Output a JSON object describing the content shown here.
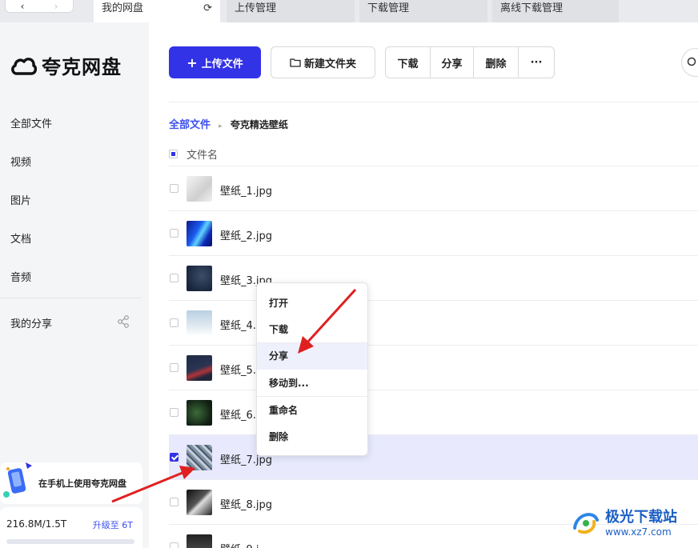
{
  "nav": {
    "back_icon": "chevron-left-icon",
    "forward_icon": "chevron-right-icon"
  },
  "tabs": [
    {
      "label": "我的网盘"
    },
    {
      "label": "上传管理"
    },
    {
      "label": "下载管理"
    },
    {
      "label": "离线下载管理"
    }
  ],
  "sidebar": {
    "app_name": "夸克网盘",
    "items": [
      {
        "label": "全部文件"
      },
      {
        "label": "视频"
      },
      {
        "label": "图片"
      },
      {
        "label": "文档"
      },
      {
        "label": "音频"
      },
      {
        "label": "我的分享"
      }
    ],
    "promo_text": "在手机上使用夸克网盘",
    "storage_used": "216.8M/1.5T",
    "upgrade_label": "升级至 6T"
  },
  "toolbar": {
    "upload_label": "上传文件",
    "new_folder_label": "新建文件夹",
    "download_label": "下载",
    "share_label": "分享",
    "delete_label": "删除",
    "more_label": "···"
  },
  "breadcrumb": {
    "root": "全部文件",
    "current": "夸克精选壁纸"
  },
  "table": {
    "column_header": "文件名",
    "rows": [
      {
        "name": "壁纸_1.jpg",
        "selected": false
      },
      {
        "name": "壁纸_2.jpg",
        "selected": false
      },
      {
        "name": "壁纸_3.jpg",
        "selected": false
      },
      {
        "name": "壁纸_4.",
        "selected": false
      },
      {
        "name": "壁纸_5.",
        "selected": false
      },
      {
        "name": "壁纸_6.",
        "selected": false
      },
      {
        "name": "壁纸_7.jpg",
        "selected": true
      },
      {
        "name": "壁纸_8.jpg",
        "selected": false
      },
      {
        "name": "壁纸_9.j",
        "selected": false
      }
    ]
  },
  "context_menu": {
    "items": [
      {
        "label": "打开"
      },
      {
        "label": "下载"
      },
      {
        "label": "分享",
        "highlighted": true
      },
      {
        "label": "移动到..."
      },
      {
        "label": "重命名"
      },
      {
        "label": "删除"
      }
    ]
  },
  "watermark": {
    "title": "极光下载站",
    "url": "www.xz7.com"
  },
  "colors": {
    "accent": "#3232e6",
    "annotation_arrow": "#e02020"
  }
}
